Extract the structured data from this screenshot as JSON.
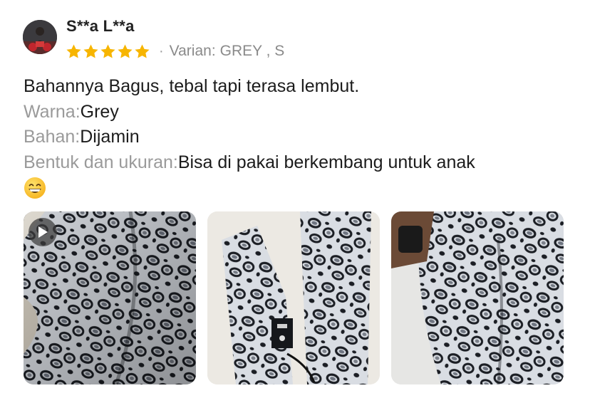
{
  "reviewer": {
    "name": "S**a L**a",
    "avatar_icon": "reviewer-avatar-photo"
  },
  "rating": {
    "stars": 5,
    "max_stars": 5,
    "star_color": "#F7B500"
  },
  "variant": {
    "label": "Varian:",
    "value": "GREY , S"
  },
  "review": {
    "headline": "Bahannya Bagus, tebal tapi terasa lembut.",
    "attributes": [
      {
        "label": "Warna:",
        "value": "Grey"
      },
      {
        "label": "Bahan:",
        "value": "Dijamin"
      },
      {
        "label": "Bentuk dan ukuran:",
        "value": "Bisa di pakai berkembang untuk anak"
      }
    ],
    "emoji_icon": "grinning-face-emoji"
  },
  "media": [
    {
      "type": "video",
      "icon": "play-icon",
      "subject": "leopard print pants"
    },
    {
      "type": "photo",
      "subject": "leopard print pants"
    },
    {
      "type": "photo",
      "subject": "leopard print pants"
    }
  ]
}
